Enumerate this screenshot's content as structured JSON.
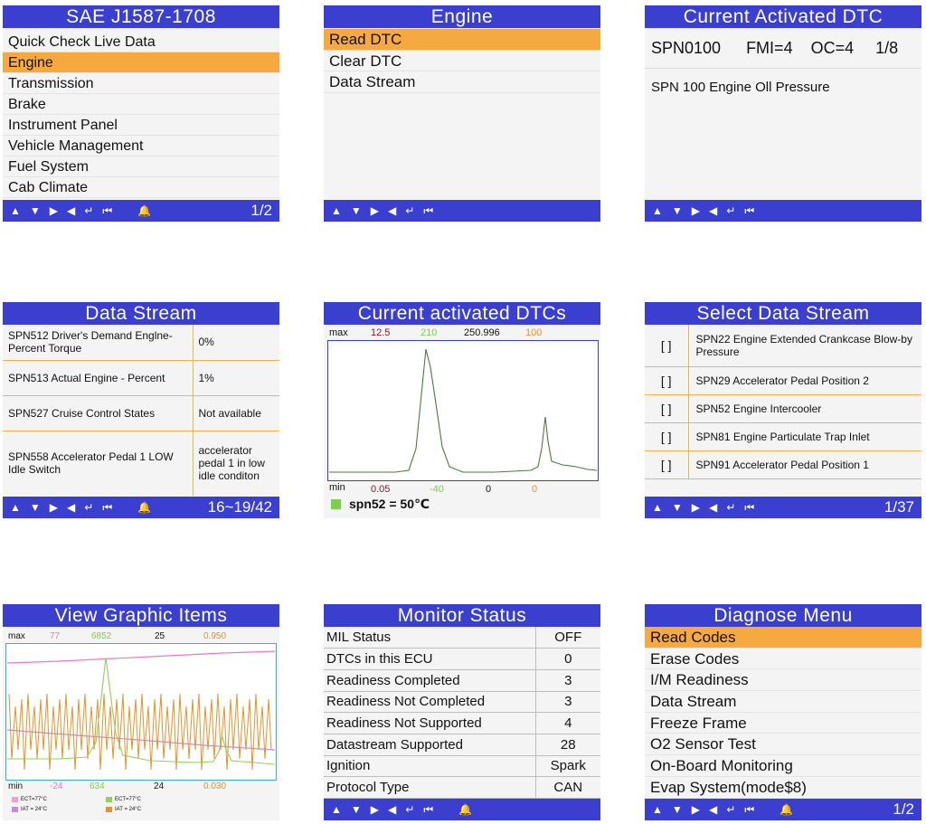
{
  "footer_icons": {
    "up": "▲",
    "down": "▼",
    "right": "▶",
    "left": "◀",
    "enter": "↵",
    "back": "⏮",
    "bell": "🔔"
  },
  "colors": {
    "title_bar": "#3a3fd0",
    "highlight": "#f5a93e",
    "max_red": "#8b1a2a",
    "green": "#7ccf4a",
    "orange": "#e8922a",
    "pink": "#e878c8"
  },
  "p1": {
    "title": "SAE J1587-1708",
    "items": [
      "Quick Check Live Data",
      "Engine",
      "Transmission",
      "Brake",
      "Instrument Panel",
      "Vehicle Management",
      "Fuel System",
      "Cab Climate"
    ],
    "selected": "Engine",
    "page": "1/2"
  },
  "p2": {
    "title": "Engine",
    "items": [
      "Read DTC",
      "Clear DTC",
      "Data Stream"
    ],
    "selected": "Read DTC"
  },
  "p3": {
    "title": "Current Activated DTC",
    "spn": "SPN0100",
    "fmi": "FMI=4",
    "oc": "OC=4",
    "count": "1/8",
    "description": "SPN 100 Engine Oll Pressure"
  },
  "p4": {
    "title": "Data Stream",
    "rows": [
      {
        "name": "SPN512 Driver's Demand Englne-Percent Torque",
        "value": "0%"
      },
      {
        "name": "SPN513 Actual Engine - Percent",
        "value": "1%"
      },
      {
        "name": "SPN527 Cruise Control States",
        "value": "Not available"
      },
      {
        "name": "SPN558 Accelerator Pedal 1 LOW Idle Switch",
        "value": "accelerator pedal 1 in low idle conditon"
      }
    ],
    "page": "16~19/42"
  },
  "p5": {
    "title": "Current activated DTCs",
    "max_label": "max",
    "max_values": [
      "12.5",
      "210",
      "250.996",
      "100"
    ],
    "min_label": "min",
    "min_values": [
      "0.05",
      "-40",
      "0",
      "0"
    ],
    "legend": "spn52 = 50℃"
  },
  "p6": {
    "title": "Select Data Stream",
    "checkbox": "[ ]",
    "rows": [
      "SPN22 Engine Extended Crankcase Blow-by Pressure",
      "SPN29 Accelerator Pedal Position 2",
      "SPN52 Engine Intercooler",
      "SPN81 Engine Particulate Trap Inlet",
      "SPN91 Accelerator Pedal Position 1"
    ],
    "page": "1/37"
  },
  "p7": {
    "title": "View Graphic Items",
    "max_label": "max",
    "max_values": [
      "77",
      "6852",
      "25",
      "0.950"
    ],
    "min_label": "min",
    "min_values": [
      "-24",
      "634",
      "24",
      "0.030"
    ],
    "legend": [
      "ECT=77°C",
      "ECT=77°C",
      "IAT = 24°C",
      "IAT = 24°C"
    ]
  },
  "p8": {
    "title": "Monitor Status",
    "rows": [
      {
        "label": "MIL Status",
        "value": "OFF"
      },
      {
        "label": "DTCs in this ECU",
        "value": "0"
      },
      {
        "label": "Readiness Completed",
        "value": "3"
      },
      {
        "label": "Readiness Not Completed",
        "value": "3"
      },
      {
        "label": "Readiness Not Supported",
        "value": "4"
      },
      {
        "label": "Datastream Supported",
        "value": "28"
      },
      {
        "label": "Ignition",
        "value": "Spark"
      },
      {
        "label": "Protocol Type",
        "value": "CAN"
      }
    ]
  },
  "p9": {
    "title": "Diagnose Menu",
    "items": [
      "Read Codes",
      "Erase Codes",
      "I/M Readiness",
      "Data Stream",
      "Freeze Frame",
      "O2 Sensor Test",
      "On-Board Monitoring",
      "Evap System(mode$8)"
    ],
    "selected": "Read Codes",
    "page": "1/2"
  }
}
